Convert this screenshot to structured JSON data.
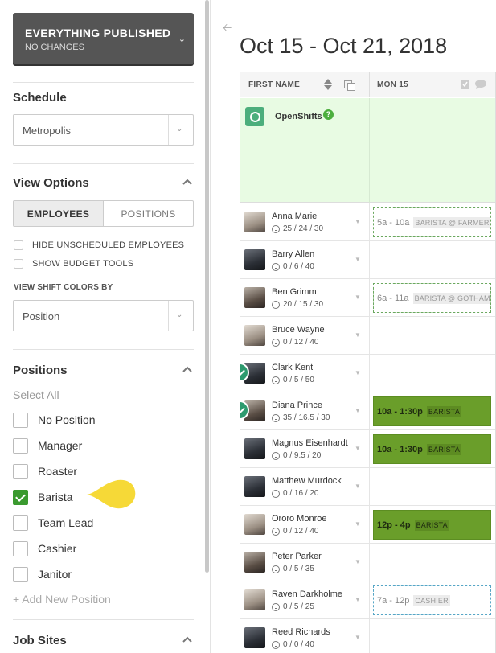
{
  "publish": {
    "title": "EVERYTHING PUBLISHED",
    "subtitle": "NO CHANGES"
  },
  "schedule": {
    "heading": "Schedule",
    "selected": "Metropolis"
  },
  "view_options": {
    "heading": "View Options",
    "tabs": [
      "EMPLOYEES",
      "POSITIONS"
    ],
    "active_tab": "EMPLOYEES",
    "checkboxes": [
      "HIDE UNSCHEDULED EMPLOYEES",
      "SHOW BUDGET TOOLS"
    ],
    "color_by_label": "VIEW SHIFT COLORS BY",
    "color_by_value": "Position"
  },
  "positions": {
    "heading": "Positions",
    "select_all": "Select All",
    "items": [
      {
        "label": "No Position",
        "checked": false
      },
      {
        "label": "Manager",
        "checked": false
      },
      {
        "label": "Roaster",
        "checked": false
      },
      {
        "label": "Barista",
        "checked": true
      },
      {
        "label": "Team Lead",
        "checked": false
      },
      {
        "label": "Cashier",
        "checked": false
      },
      {
        "label": "Janitor",
        "checked": false
      }
    ],
    "add_new": "+ Add New Position"
  },
  "job_sites": {
    "heading": "Job Sites"
  },
  "main": {
    "date_range": "Oct 15 - Oct 21, 2018",
    "col_first_name": "FIRST NAME",
    "col_day": "MON 15",
    "open_shifts": "OpenShifts",
    "help": "?"
  },
  "employees": [
    {
      "name": "Anna Marie",
      "hours": "25 / 24 / 30",
      "status": false,
      "shift": {
        "time": "5a - 10a",
        "position": "BARISTA @ FARMERS",
        "style": "draft"
      }
    },
    {
      "name": "Barry Allen",
      "hours": "0 / 6 / 40",
      "status": false,
      "shift": null
    },
    {
      "name": "Ben Grimm",
      "hours": "20 / 15 / 30",
      "status": false,
      "shift": {
        "time": "6a - 11a",
        "position": "BARISTA @ GOTHAM",
        "style": "draft"
      }
    },
    {
      "name": "Bruce Wayne",
      "hours": "0 / 12 / 40",
      "status": false,
      "shift": null
    },
    {
      "name": "Clark Kent",
      "hours": "0 / 5 / 50",
      "status": true,
      "shift": null
    },
    {
      "name": "Diana Prince",
      "hours": "35 / 16.5 / 30",
      "status": true,
      "shift": {
        "time": "10a - 1:30p",
        "position": "BARISTA",
        "style": "pub"
      }
    },
    {
      "name": "Magnus Eisenhardt",
      "hours": "0 / 9.5 / 20",
      "status": false,
      "shift": {
        "time": "10a - 1:30p",
        "position": "BARISTA",
        "style": "pub"
      }
    },
    {
      "name": "Matthew Murdock",
      "hours": "0 / 16 / 20",
      "status": false,
      "shift": null
    },
    {
      "name": "Ororo Monroe",
      "hours": "0 / 12 / 40",
      "status": false,
      "shift": {
        "time": "12p - 4p",
        "position": "BARISTA",
        "style": "pub"
      }
    },
    {
      "name": "Peter Parker",
      "hours": "0 / 5 / 35",
      "status": false,
      "shift": null
    },
    {
      "name": "Raven Darkholme",
      "hours": "0 / 5 / 25",
      "status": false,
      "shift": {
        "time": "7a - 12p",
        "position": "CASHIER",
        "style": "draft-blue"
      }
    },
    {
      "name": "Reed Richards",
      "hours": "0 / 0 / 40",
      "status": false,
      "shift": null
    }
  ],
  "colors": {
    "publish_bg": "#555555",
    "open_row_bg": "#e8fbe3",
    "published_shift": "#6a9e2a",
    "check": "#3a9a2f"
  }
}
